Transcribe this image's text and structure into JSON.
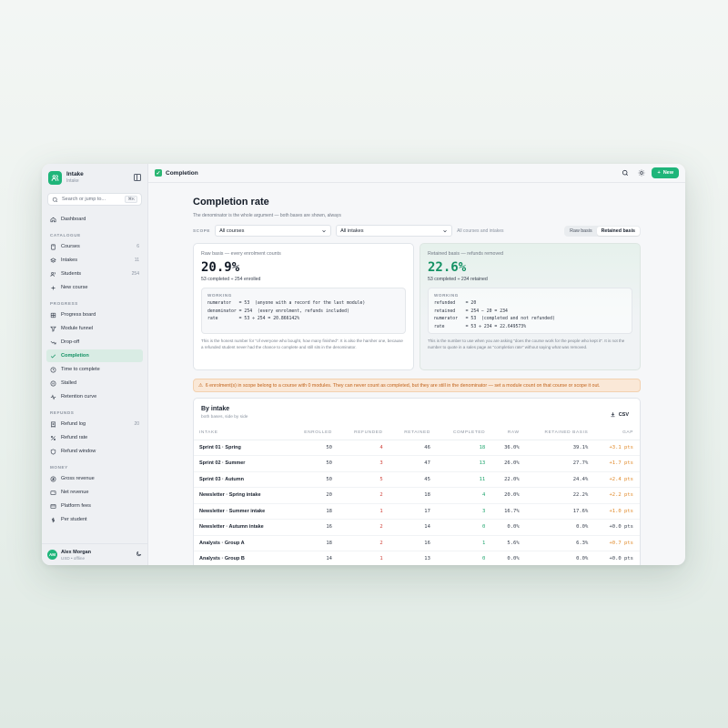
{
  "brand": {
    "title": "Intake",
    "subtitle": "Intake"
  },
  "search": {
    "placeholder": "Search or jump to...",
    "shortcut": "⌘K"
  },
  "nav": {
    "dashboard": "Dashboard",
    "catalogue_heading": "CATALOGUE",
    "catalogue": [
      {
        "label": "Courses",
        "count": "6",
        "icon": "book-icon"
      },
      {
        "label": "Intakes",
        "count": "11",
        "icon": "layers-icon"
      },
      {
        "label": "Students",
        "count": "254",
        "icon": "users-icon"
      },
      {
        "label": "New course",
        "count": "",
        "icon": "plus-icon"
      }
    ],
    "progress_heading": "PROGRESS",
    "progress": [
      {
        "label": "Progress board",
        "icon": "grid-icon"
      },
      {
        "label": "Module funnel",
        "icon": "funnel-icon"
      },
      {
        "label": "Drop-off",
        "icon": "trend-down-icon"
      },
      {
        "label": "Completion",
        "icon": "check-icon",
        "active": true
      },
      {
        "label": "Time to complete",
        "icon": "clock-icon"
      },
      {
        "label": "Stalled",
        "icon": "pause-icon"
      },
      {
        "label": "Retention curve",
        "icon": "activity-icon"
      }
    ],
    "refunds_heading": "REFUNDS",
    "refunds": [
      {
        "label": "Refund log",
        "count": "20",
        "icon": "receipt-icon"
      },
      {
        "label": "Refund rate",
        "icon": "percent-icon"
      },
      {
        "label": "Refund window",
        "icon": "shield-icon"
      }
    ],
    "money_heading": "MONEY",
    "money": [
      {
        "label": "Gross revenue",
        "icon": "coin-icon"
      },
      {
        "label": "Net revenue",
        "icon": "wallet-icon"
      },
      {
        "label": "Platform fees",
        "icon": "card-icon"
      },
      {
        "label": "Per student",
        "icon": "dollar-icon"
      }
    ]
  },
  "user": {
    "initials": "AM",
    "name": "Alex Morgan",
    "sub": "USD • offline"
  },
  "topbar": {
    "title": "Completion",
    "new_label": "New"
  },
  "page": {
    "title": "Completion rate",
    "subtitle": "The denominator is the whole argument — both bases are shown, always"
  },
  "filters": {
    "scope_label": "SCOPE",
    "course_value": "All courses",
    "intake_value": "All intakes",
    "note": "All courses and intakes",
    "toggle_raw": "Raw basis",
    "toggle_retained": "Retained basis"
  },
  "raw_card": {
    "title": "Raw basis — every enrolment counts",
    "rate": "20.9%",
    "sub": "53 completed ÷ 254 enrolled",
    "working_title": "WORKING",
    "lines": [
      "numerator   = 53  (anyone with a record for the last module)",
      "denominator = 254  (every enrolment, refunds included)"
    ],
    "rate_line": "rate        = 53 ÷ 254 = 20.866142%",
    "foot": "This is the honest number for \"of everyone who bought, how many finished\". It is also the harsher one, because a refunded student never had the chance to complete and still sits in the denominator."
  },
  "retained_card": {
    "title": "Retained basis — refunds removed",
    "rate": "22.6%",
    "sub": "53 completed ÷ 234 retained",
    "working_title": "WORKING",
    "lines": [
      "refunded    = 20",
      "retained    = 254 − 20 = 234",
      "numerator   = 53  (completed and not refunded)"
    ],
    "rate_line": "rate        = 53 ÷ 234 = 22.649573%",
    "foot": "This is the number to use when you are asking \"does the course work for the people who kept it\". It is not the number to quote in a sales page as \"completion rate\" without saying what was removed."
  },
  "warning": "6 enrolment(s) in scope belong to a course with 0 modules. They can never count as completed, but they are still in the denominator — set a module count on that course or scope it out.",
  "table": {
    "title": "By intake",
    "subtitle": "both bases, side by side",
    "csv_label": "CSV",
    "headers": [
      "INTAKE",
      "ENROLLED",
      "REFUNDED",
      "RETAINED",
      "COMPLETED",
      "RAW",
      "RETAINED BASIS",
      "GAP"
    ],
    "rows": [
      [
        "Sprint 01 · Spring",
        "50",
        "4",
        "46",
        "18",
        "36.0%",
        "39.1%",
        "+3.1 pts"
      ],
      [
        "Sprint 02 · Summer",
        "50",
        "3",
        "47",
        "13",
        "26.0%",
        "27.7%",
        "+1.7 pts"
      ],
      [
        "Sprint 03 · Autumn",
        "50",
        "5",
        "45",
        "11",
        "22.0%",
        "24.4%",
        "+2.4 pts"
      ],
      [
        "Newsletter · Spring intake",
        "20",
        "2",
        "18",
        "4",
        "20.0%",
        "22.2%",
        "+2.2 pts"
      ],
      [
        "Newsletter · Summer intake",
        "18",
        "1",
        "17",
        "3",
        "16.7%",
        "17.6%",
        "+1.0 pts"
      ],
      [
        "Newsletter · Autumn intake",
        "16",
        "2",
        "14",
        "0",
        "0.0%",
        "0.0%",
        "+0.0 pts"
      ],
      [
        "Analysts · Group A",
        "18",
        "2",
        "16",
        "1",
        "5.6%",
        "6.3%",
        "+0.7 pts"
      ],
      [
        "Analysts · Group B",
        "14",
        "1",
        "13",
        "0",
        "0.0%",
        "0.0%",
        "+0.0 pts"
      ]
    ]
  },
  "colors": {
    "accent": "#1fb57a",
    "accent_dark": "#129163",
    "refund": "#d0423a",
    "gap": "#e18a2a",
    "warning_bg": "#fae8d7"
  }
}
